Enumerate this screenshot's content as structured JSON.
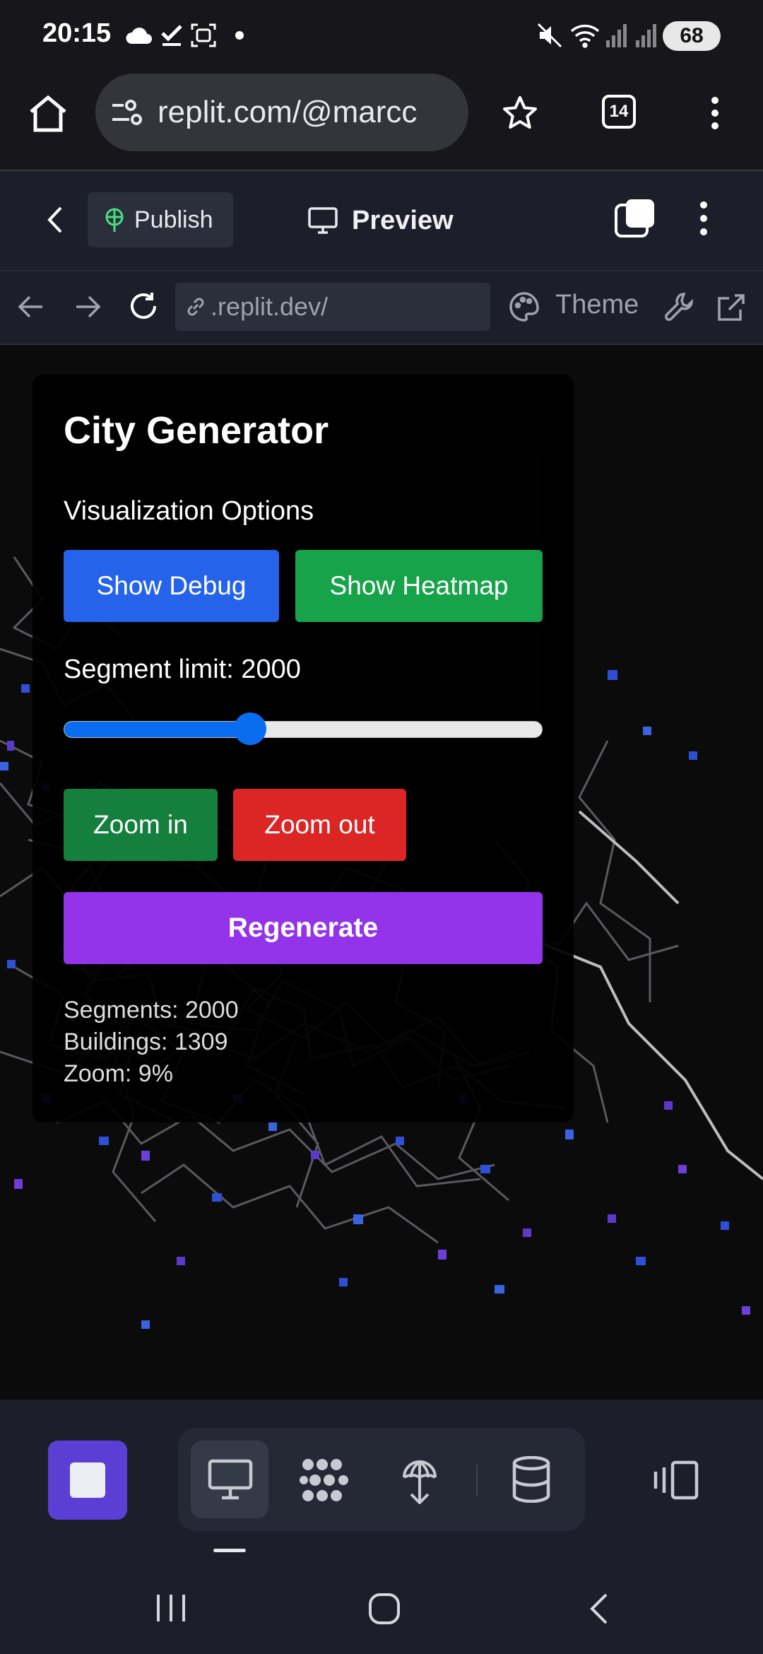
{
  "status_bar": {
    "time": "20:15",
    "battery": "68",
    "icons": [
      "cloud-icon",
      "checkmark-icon",
      "screenshot-icon",
      "dot-icon",
      "mute-icon",
      "wifi-icon",
      "signal-icon",
      "signal-icon-2"
    ]
  },
  "browser": {
    "url": "replit.com/@marcc",
    "tab_count": "14",
    "icons": [
      "home-icon",
      "site-settings-icon",
      "star-icon",
      "tabs-icon",
      "more-vert-icon"
    ]
  },
  "replit_header": {
    "publish_label": "Publish",
    "preview_label": "Preview"
  },
  "preview_toolbar": {
    "address": ".replit.dev/",
    "theme_label": "Theme"
  },
  "panel": {
    "title": "City Generator",
    "options_label": "Visualization Options",
    "show_debug": "Show Debug",
    "show_heatmap": "Show Heatmap",
    "segment_label": "Segment limit: 2000",
    "slider_fraction": 0.39,
    "zoom_in": "Zoom in",
    "zoom_out": "Zoom out",
    "regenerate": "Regenerate",
    "stats": {
      "segments": "Segments: 2000",
      "buildings": "Buildings: 1309",
      "zoom": "Zoom: 9%"
    }
  },
  "colors": {
    "debug": "#2563eb",
    "heatmap": "#16a34a",
    "zoom_in": "#15803d",
    "zoom_out": "#dc2626",
    "regenerate": "#9333ea",
    "slider": "#0a6df0"
  }
}
